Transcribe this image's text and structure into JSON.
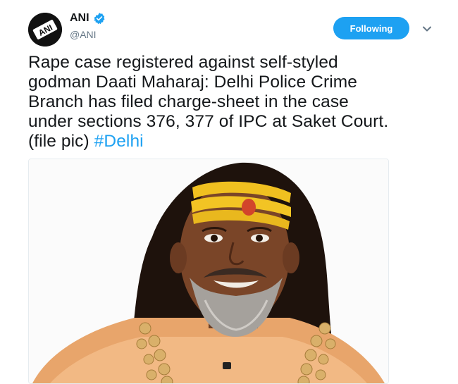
{
  "account": {
    "display_name": "ANI",
    "handle": "@ANI",
    "avatar_text": "ANI",
    "verified": true
  },
  "actions": {
    "follow_label": "Following"
  },
  "tweet": {
    "line1": "Rape case registered against self-styled",
    "line2": "godman Daati Maharaj: Delhi Police Crime",
    "line3": "Branch has filed charge-sheet in the case",
    "line4": "under sections 376, 377 of IPC at Saket Court.",
    "line5_text": "(file pic) ",
    "hashtag": "#Delhi"
  },
  "colors": {
    "accent": "#1da1f2",
    "text": "#14171a",
    "muted": "#657786"
  },
  "icons": {
    "verified": "verified-badge-icon",
    "caret": "chevron-down-icon"
  }
}
